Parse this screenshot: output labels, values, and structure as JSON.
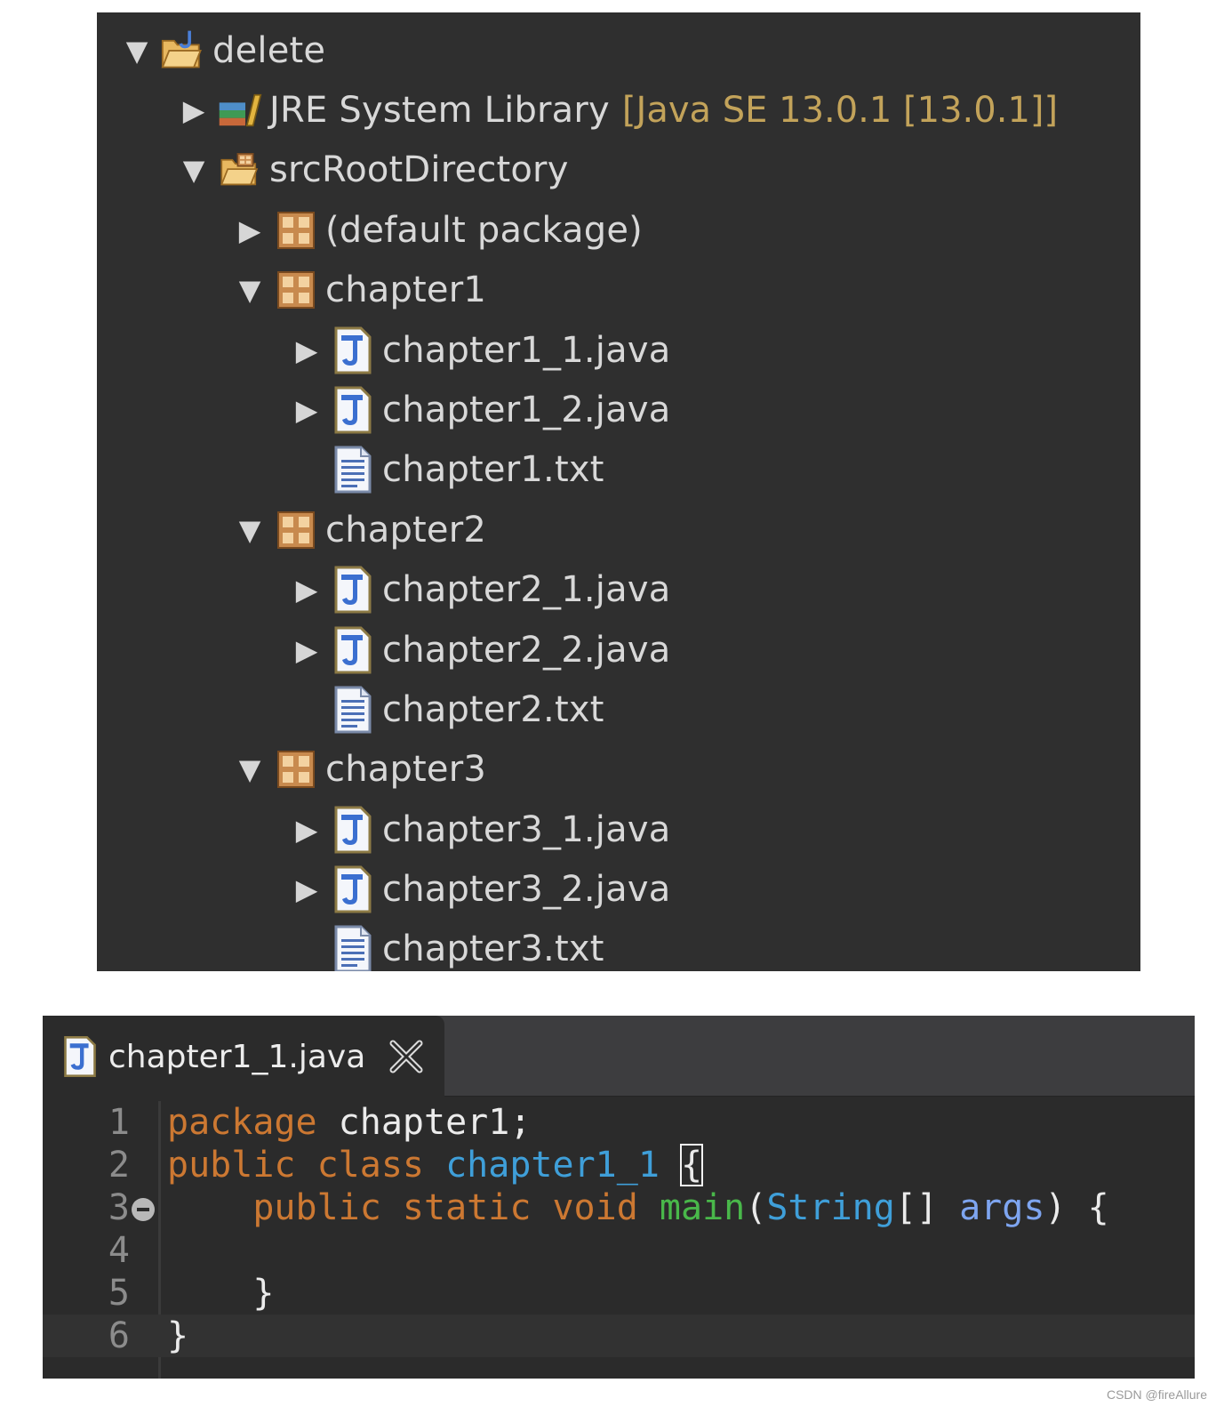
{
  "explorer": {
    "project": {
      "label": "delete",
      "icon": "java-project-icon",
      "expanded": true
    },
    "jre": {
      "label": "JRE System Library",
      "decoration": "[Java SE 13.0.1 [13.0.1]]",
      "icon": "library-icon",
      "expanded": false
    },
    "src": {
      "label": "srcRootDirectory",
      "icon": "source-folder-icon",
      "expanded": true
    },
    "items": [
      {
        "label": "(default package)",
        "icon": "package-icon",
        "expanded": false
      },
      {
        "label": "chapter1",
        "icon": "package-icon",
        "expanded": true
      },
      {
        "label": "chapter1_1.java",
        "icon": "java-file-icon",
        "expanded": false
      },
      {
        "label": "chapter1_2.java",
        "icon": "java-file-icon",
        "expanded": false
      },
      {
        "label": "chapter1.txt",
        "icon": "text-file-icon"
      },
      {
        "label": "chapter2",
        "icon": "package-icon",
        "expanded": true
      },
      {
        "label": "chapter2_1.java",
        "icon": "java-file-icon",
        "expanded": false
      },
      {
        "label": "chapter2_2.java",
        "icon": "java-file-icon",
        "expanded": false
      },
      {
        "label": "chapter2.txt",
        "icon": "text-file-icon"
      },
      {
        "label": "chapter3",
        "icon": "package-icon",
        "expanded": true
      },
      {
        "label": "chapter3_1.java",
        "icon": "java-file-icon",
        "expanded": false
      },
      {
        "label": "chapter3_2.java",
        "icon": "java-file-icon",
        "expanded": false
      },
      {
        "label": "chapter3.txt",
        "icon": "text-file-icon"
      }
    ]
  },
  "editor": {
    "tab": {
      "title": "chapter1_1.java",
      "icon": "java-file-icon",
      "close_icon": "close-icon"
    },
    "line_numbers": [
      "1",
      "2",
      "3",
      "4",
      "5",
      "6"
    ],
    "tokens": {
      "l1_kw": "package",
      "l1_rest": " chapter1;",
      "l2_kw": "public class",
      "l2_type": "chapter1_1",
      "l2_brace": "{",
      "l3_indent": "    ",
      "l3_kw": "public static void",
      "l3_fn": "main",
      "l3_p1": "(",
      "l3_type": "String",
      "l3_p2": "[] ",
      "l3_param": "args",
      "l3_p3": ") {",
      "l5": "    }",
      "l6": "}"
    }
  },
  "colors": {
    "panel_bg": "#2f2f2f",
    "editor_bg": "#2b2b2b",
    "keyword": "#cc7832",
    "type": "#3f9fd9",
    "method": "#49b84a",
    "parameter": "#7ea5f0",
    "decoration": "#c3a35a"
  },
  "watermark": "CSDN @fireAllure"
}
